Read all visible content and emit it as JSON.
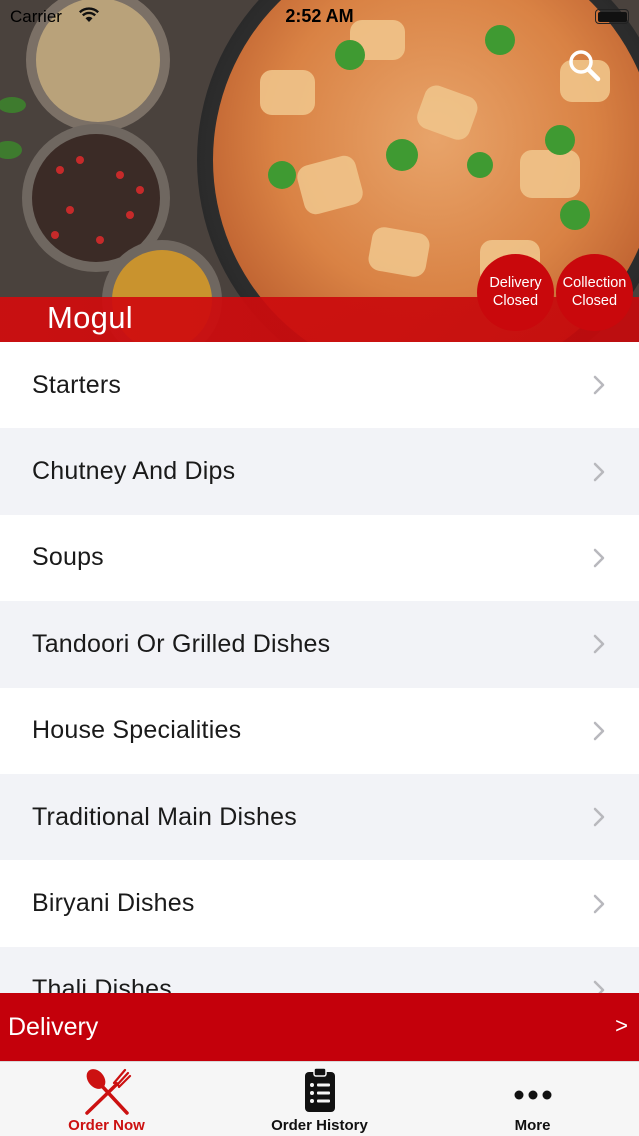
{
  "status_bar": {
    "carrier": "Carrier",
    "time": "2:52 AM"
  },
  "restaurant": {
    "name": "Mogul"
  },
  "badges": {
    "delivery": {
      "line1": "Delivery",
      "line2": "Closed"
    },
    "collection": {
      "line1": "Collection",
      "line2": "Closed"
    }
  },
  "menu": {
    "items": [
      {
        "label": "Starters"
      },
      {
        "label": "Chutney And Dips"
      },
      {
        "label": "Soups"
      },
      {
        "label": "Tandoori Or Grilled Dishes"
      },
      {
        "label": "House Specialities"
      },
      {
        "label": "Traditional Main Dishes"
      },
      {
        "label": "Biryani Dishes"
      },
      {
        "label": "Thali Dishes"
      }
    ]
  },
  "delivery_bar": {
    "label": "Delivery",
    "arrow": ">"
  },
  "tabs": {
    "order_now": "Order Now",
    "order_history": "Order History",
    "more": "More"
  },
  "colors": {
    "brand_red": "#c4000b",
    "active_tab": "#cc1111",
    "row_alt": "#f2f3f7"
  },
  "icons": {
    "search": "search-icon",
    "chevron": "chevron-right-icon",
    "order_now": "fork-knife-icon",
    "order_history": "clipboard-list-icon",
    "more": "more-dots-icon"
  }
}
